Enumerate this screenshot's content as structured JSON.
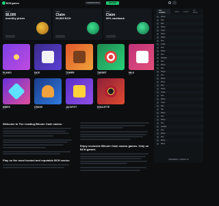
{
  "header": {
    "logo": "BCH.games",
    "wallet_balance": "0.00000000 BCH",
    "deposit_label": "DEPOSIT"
  },
  "promos": [
    {
      "tag": "Bonus",
      "big": "$6,000",
      "sub": "monthly prizes"
    },
    {
      "tag": "Claim",
      "big": "Claim",
      "sub": "69,563 BCH"
    },
    {
      "tag": "Claim",
      "big": "Claim",
      "sub": "30% cashback"
    }
  ],
  "games": [
    {
      "name": "PLINKO",
      "sub": "BCH"
    },
    {
      "name": "DICE",
      "sub": "BCH"
    },
    {
      "name": "TOWER",
      "sub": "BCH"
    },
    {
      "name": "TARGET",
      "sub": "BCH"
    },
    {
      "name": "HILO",
      "sub": "BCH"
    },
    {
      "name": "MINES",
      "sub": "BCH"
    },
    {
      "name": "CRASH",
      "sub": "BCH"
    },
    {
      "name": "JACKPOT",
      "sub": "BCH"
    },
    {
      "name": "ROULETTE",
      "sub": "BCH"
    },
    {
      "name": "",
      "sub": ""
    }
  ],
  "side_panel": {
    "tabs": [
      "ALL GAMES",
      "HIGH",
      "LUCKY",
      "MY BETS"
    ],
    "rows": [
      {
        "game": "Plinko",
        "user": "",
        "amount": ""
      },
      {
        "game": "Dice",
        "user": "",
        "amount": ""
      },
      {
        "game": "Dice",
        "user": "",
        "amount": ""
      },
      {
        "game": "Plinko",
        "user": "",
        "amount": ""
      },
      {
        "game": "Tower",
        "user": "",
        "amount": ""
      },
      {
        "game": "Mines",
        "user": "",
        "amount": ""
      },
      {
        "game": "Plinko",
        "user": "",
        "amount": ""
      },
      {
        "game": "Dice",
        "user": "",
        "amount": ""
      },
      {
        "game": "Crash",
        "user": "",
        "amount": ""
      },
      {
        "game": "Dice",
        "user": "",
        "amount": ""
      },
      {
        "game": "Plinko",
        "user": "",
        "amount": ""
      },
      {
        "game": "Dice",
        "user": "",
        "amount": ""
      },
      {
        "game": "Roulette",
        "user": "",
        "amount": ""
      },
      {
        "game": "Dice",
        "user": "",
        "amount": ""
      },
      {
        "game": "Plinko",
        "user": "",
        "amount": ""
      },
      {
        "game": "Dice",
        "user": "",
        "amount": ""
      },
      {
        "game": "Target",
        "user": "",
        "amount": ""
      },
      {
        "game": "Dice",
        "user": "",
        "amount": ""
      },
      {
        "game": "Plinko",
        "user": "",
        "amount": ""
      },
      {
        "game": "Mines",
        "user": "",
        "amount": ""
      },
      {
        "game": "Dice",
        "user": "",
        "amount": ""
      },
      {
        "game": "Plinko",
        "user": "",
        "amount": ""
      },
      {
        "game": "Crash",
        "user": "",
        "amount": ""
      },
      {
        "game": "Dice",
        "user": "",
        "amount": ""
      },
      {
        "game": "Plinko",
        "user": "",
        "amount": ""
      },
      {
        "game": "Tower",
        "user": "",
        "amount": ""
      },
      {
        "game": "Dice",
        "user": "",
        "amount": ""
      },
      {
        "game": "Hilo",
        "user": "",
        "amount": ""
      },
      {
        "game": "Plinko",
        "user": "",
        "amount": ""
      },
      {
        "game": "Dice",
        "user": "",
        "amount": ""
      },
      {
        "game": "Plinko",
        "user": "",
        "amount": ""
      },
      {
        "game": "Dice",
        "user": "",
        "amount": ""
      },
      {
        "game": "Jackpot",
        "user": "",
        "amount": ""
      },
      {
        "game": "Dice",
        "user": "",
        "amount": ""
      },
      {
        "game": "Plinko",
        "user": "",
        "amount": ""
      },
      {
        "game": "Dice",
        "user": "",
        "amount": ""
      },
      {
        "game": "Plinko",
        "user": "",
        "amount": ""
      },
      {
        "game": "Mines",
        "user": "",
        "amount": ""
      }
    ],
    "footer": "WAGERED 7,148,867.13"
  },
  "about": {
    "left_title": "Welcome to The Leading Bitcoin Cash casino",
    "mid_title": "Enjoy exclusive Bitcoin Cash casino games. Only on BCH.games",
    "bottom_title": "Play on the most trusted and reputable BCH casino"
  },
  "colors": {
    "accent": "#1fd37a",
    "background": "#0c0e10",
    "panel": "#14181c"
  }
}
